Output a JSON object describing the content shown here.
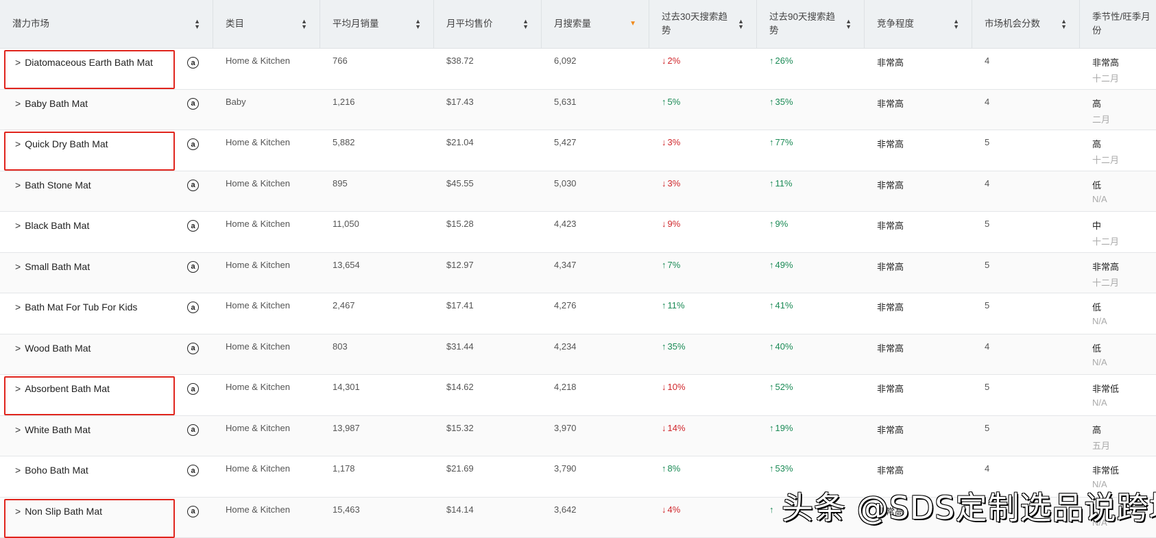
{
  "headers": [
    {
      "label": "潜力市场",
      "sort": "both"
    },
    {
      "label": "类目",
      "sort": "both"
    },
    {
      "label": "平均月销量",
      "sort": "both"
    },
    {
      "label": "月平均售价",
      "sort": "both"
    },
    {
      "label": "月搜索量",
      "sort": "desc"
    },
    {
      "label": "过去30天搜索趋势",
      "sort": "both"
    },
    {
      "label": "过去90天搜索趋势",
      "sort": "both"
    },
    {
      "label": "竞争程度",
      "sort": "both"
    },
    {
      "label": "市场机会分数",
      "sort": "both"
    },
    {
      "label": "季节性/旺季月份",
      "sort": "none"
    }
  ],
  "expand_icon": "chevron-right-icon",
  "marketplace_icon": "amazon-icon",
  "marketplace_glyph": "a",
  "colors": {
    "down": "#d0262b",
    "up": "#1a8a55",
    "highlight": "#e0241c",
    "sort_active": "#f08a1c"
  },
  "rows": [
    {
      "name": "Diatomaceous Earth Bath Mat",
      "category": "Home & Kitchen",
      "sales": "766",
      "price": "$38.72",
      "search": "6,092",
      "t30": {
        "dir": "down",
        "val": "2%"
      },
      "t90": {
        "dir": "up",
        "val": "26%"
      },
      "competition": "非常高",
      "score": "4",
      "season": "非常高",
      "peak": "十二月",
      "highlighted": true
    },
    {
      "name": "Baby Bath Mat",
      "category": "Baby",
      "sales": "1,216",
      "price": "$17.43",
      "search": "5,631",
      "t30": {
        "dir": "up",
        "val": "5%"
      },
      "t90": {
        "dir": "up",
        "val": "35%"
      },
      "competition": "非常高",
      "score": "4",
      "season": "高",
      "peak": "二月",
      "highlighted": false
    },
    {
      "name": "Quick Dry Bath Mat",
      "category": "Home & Kitchen",
      "sales": "5,882",
      "price": "$21.04",
      "search": "5,427",
      "t30": {
        "dir": "down",
        "val": "3%"
      },
      "t90": {
        "dir": "up",
        "val": "77%"
      },
      "competition": "非常高",
      "score": "5",
      "season": "高",
      "peak": "十二月",
      "highlighted": true
    },
    {
      "name": "Bath Stone Mat",
      "category": "Home & Kitchen",
      "sales": "895",
      "price": "$45.55",
      "search": "5,030",
      "t30": {
        "dir": "down",
        "val": "3%"
      },
      "t90": {
        "dir": "up",
        "val": "11%"
      },
      "competition": "非常高",
      "score": "4",
      "season": "低",
      "peak": "N/A",
      "highlighted": false
    },
    {
      "name": "Black Bath Mat",
      "category": "Home & Kitchen",
      "sales": "11,050",
      "price": "$15.28",
      "search": "4,423",
      "t30": {
        "dir": "down",
        "val": "9%"
      },
      "t90": {
        "dir": "up",
        "val": "9%"
      },
      "competition": "非常高",
      "score": "5",
      "season": "中",
      "peak": "十二月",
      "highlighted": false
    },
    {
      "name": "Small Bath Mat",
      "category": "Home & Kitchen",
      "sales": "13,654",
      "price": "$12.97",
      "search": "4,347",
      "t30": {
        "dir": "up",
        "val": "7%"
      },
      "t90": {
        "dir": "up",
        "val": "49%"
      },
      "competition": "非常高",
      "score": "5",
      "season": "非常高",
      "peak": "十二月",
      "highlighted": false
    },
    {
      "name": "Bath Mat For Tub For Kids",
      "category": "Home & Kitchen",
      "sales": "2,467",
      "price": "$17.41",
      "search": "4,276",
      "t30": {
        "dir": "up",
        "val": "11%"
      },
      "t90": {
        "dir": "up",
        "val": "41%"
      },
      "competition": "非常高",
      "score": "5",
      "season": "低",
      "peak": "N/A",
      "highlighted": false
    },
    {
      "name": "Wood Bath Mat",
      "category": "Home & Kitchen",
      "sales": "803",
      "price": "$31.44",
      "search": "4,234",
      "t30": {
        "dir": "up",
        "val": "35%"
      },
      "t90": {
        "dir": "up",
        "val": "40%"
      },
      "competition": "非常高",
      "score": "4",
      "season": "低",
      "peak": "N/A",
      "highlighted": false
    },
    {
      "name": "Absorbent Bath Mat",
      "category": "Home & Kitchen",
      "sales": "14,301",
      "price": "$14.62",
      "search": "4,218",
      "t30": {
        "dir": "down",
        "val": "10%"
      },
      "t90": {
        "dir": "up",
        "val": "52%"
      },
      "competition": "非常高",
      "score": "5",
      "season": "非常低",
      "peak": "N/A",
      "highlighted": true
    },
    {
      "name": "White Bath Mat",
      "category": "Home & Kitchen",
      "sales": "13,987",
      "price": "$15.32",
      "search": "3,970",
      "t30": {
        "dir": "down",
        "val": "14%"
      },
      "t90": {
        "dir": "up",
        "val": "19%"
      },
      "competition": "非常高",
      "score": "5",
      "season": "高",
      "peak": "五月",
      "highlighted": false
    },
    {
      "name": "Boho Bath Mat",
      "category": "Home & Kitchen",
      "sales": "1,178",
      "price": "$21.69",
      "search": "3,790",
      "t30": {
        "dir": "up",
        "val": "8%"
      },
      "t90": {
        "dir": "up",
        "val": "53%"
      },
      "competition": "非常高",
      "score": "4",
      "season": "非常低",
      "peak": "N/A",
      "highlighted": false
    },
    {
      "name": "Non Slip Bath Mat",
      "category": "Home & Kitchen",
      "sales": "15,463",
      "price": "$14.14",
      "search": "3,642",
      "t30": {
        "dir": "down",
        "val": "4%"
      },
      "t90": {
        "dir": "up",
        "val": ""
      },
      "competition": "非常高",
      "score": "",
      "season": "",
      "peak": "N/A",
      "highlighted": true
    }
  ],
  "watermark": "头条 @SDS定制选品说跨境"
}
